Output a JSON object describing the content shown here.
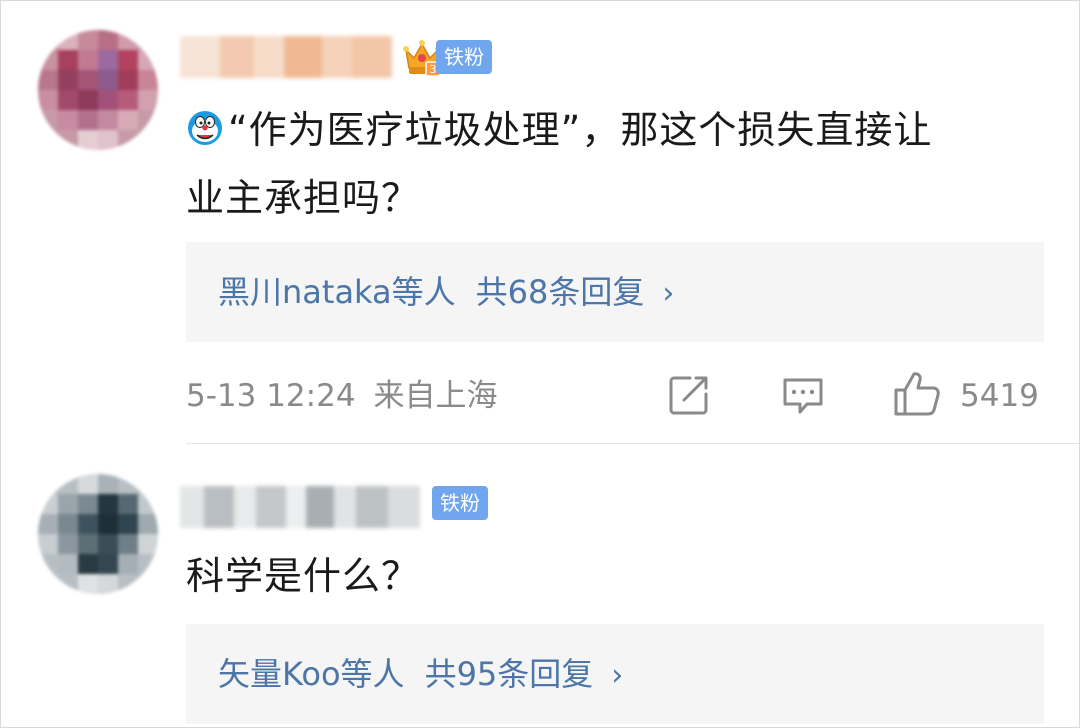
{
  "comments": [
    {
      "badge": "铁粉",
      "text_line1": "“作为医疗垃圾处理”，那这个损失直接让",
      "text_line2": "业主承担吗？",
      "reply_users": "黑川nataka等人",
      "reply_count": "共68条回复",
      "reply_chevron": "›",
      "time": "5-13 12:24",
      "location": "来自上海",
      "likes": "5419"
    },
    {
      "badge": "铁粉",
      "text_line1": "科学是什么？",
      "reply_users": "矢量Koo等人",
      "reply_count": "共95条回复",
      "reply_chevron": "›"
    }
  ],
  "colors": {
    "link": "#4c76a8",
    "badge": "#6fa6ee",
    "meta": "#8a8a8a",
    "reply_bg": "#f5f5f5"
  },
  "icons": {
    "fan_level": "crown-badge-icon",
    "emoji": "doraemon-emoji-icon",
    "repost": "repost-icon",
    "comment": "comment-icon",
    "like": "thumbs-up-icon",
    "chevron": "chevron-right-icon"
  }
}
